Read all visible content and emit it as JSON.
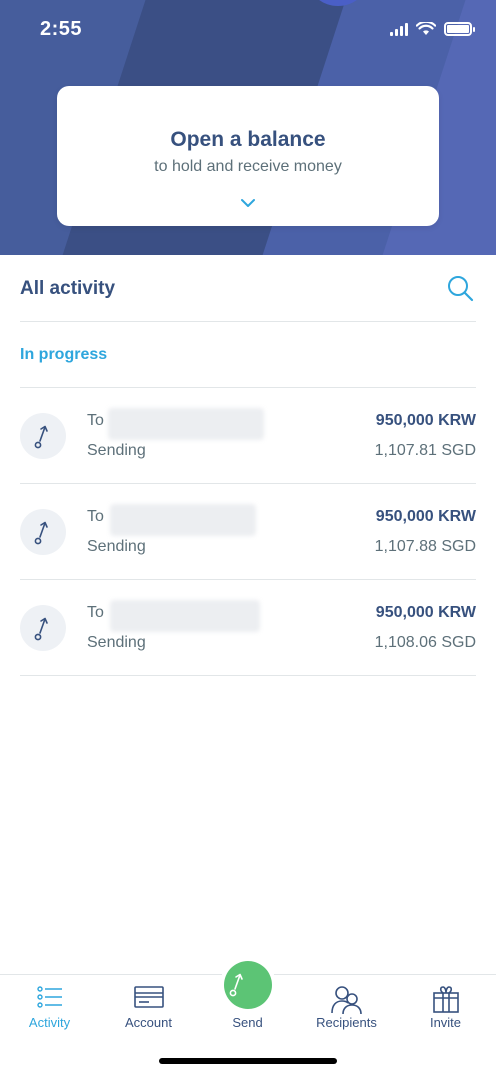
{
  "status_bar": {
    "time": "2:55"
  },
  "balance_card": {
    "title": "Open a balance",
    "subtitle": "to hold and receive money"
  },
  "activity": {
    "title": "All activity",
    "section_label": "In progress",
    "transactions": [
      {
        "to_label": "To",
        "status": "Sending",
        "amount": "950,000 KRW",
        "converted": "1,107.81 SGD"
      },
      {
        "to_label": "To",
        "status": "Sending",
        "amount": "950,000 KRW",
        "converted": "1,107.88 SGD"
      },
      {
        "to_label": "To",
        "status": "Sending",
        "amount": "950,000 KRW",
        "converted": "1,108.06 SGD"
      }
    ]
  },
  "tab_bar": {
    "items": [
      {
        "label": "Activity",
        "icon": "list-icon",
        "active": true
      },
      {
        "label": "Account",
        "icon": "card-icon",
        "active": false
      },
      {
        "label": "Send",
        "icon": "send-arrow-icon",
        "active": false
      },
      {
        "label": "Recipients",
        "icon": "people-icon",
        "active": false
      },
      {
        "label": "Invite",
        "icon": "gift-icon",
        "active": false
      }
    ]
  },
  "colors": {
    "header_bg": "#3b4f85",
    "accent_blue": "#2ea6dd",
    "send_green": "#5cc475",
    "text_primary": "#37517e"
  }
}
